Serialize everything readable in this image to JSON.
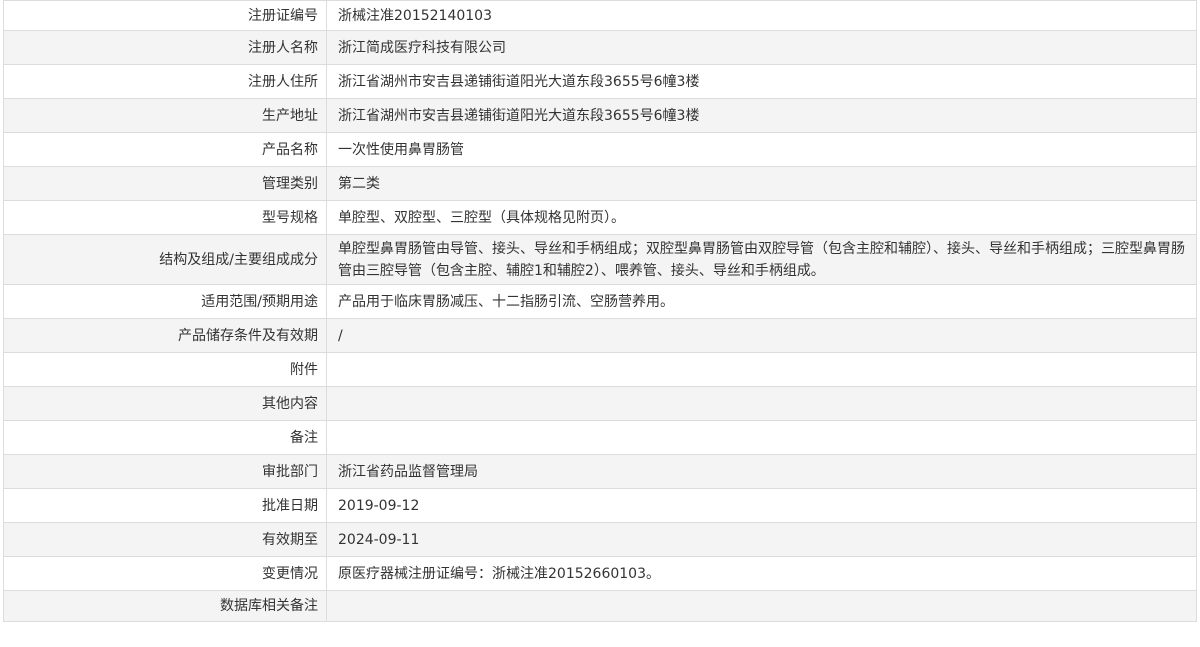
{
  "record": {
    "rows": [
      {
        "label": "注册证编号",
        "value": "浙械注准20152140103"
      },
      {
        "label": "注册人名称",
        "value": "浙江简成医疗科技有限公司"
      },
      {
        "label": "注册人住所",
        "value": "浙江省湖州市安吉县递铺街道阳光大道东段3655号6幢3楼"
      },
      {
        "label": "生产地址",
        "value": "浙江省湖州市安吉县递铺街道阳光大道东段3655号6幢3楼"
      },
      {
        "label": "产品名称",
        "value": "一次性使用鼻胃肠管"
      },
      {
        "label": "管理类别",
        "value": "第二类"
      },
      {
        "label": "型号规格",
        "value": "单腔型、双腔型、三腔型（具体规格见附页）。"
      },
      {
        "label": "结构及组成/主要组成成分",
        "value": "单腔型鼻胃肠管由导管、接头、导丝和手柄组成；双腔型鼻胃肠管由双腔导管（包含主腔和辅腔）、接头、导丝和手柄组成；三腔型鼻胃肠管由三腔导管（包含主腔、辅腔1和辅腔2）、喂养管、接头、导丝和手柄组成。"
      },
      {
        "label": "适用范围/预期用途",
        "value": "产品用于临床胃肠减压、十二指肠引流、空肠营养用。"
      },
      {
        "label": "产品储存条件及有效期",
        "value": "/"
      },
      {
        "label": "附件",
        "value": ""
      },
      {
        "label": "其他内容",
        "value": ""
      },
      {
        "label": "备注",
        "value": ""
      },
      {
        "label": "审批部门",
        "value": "浙江省药品监督管理局"
      },
      {
        "label": "批准日期",
        "value": "2019-09-12"
      },
      {
        "label": "有效期至",
        "value": "2024-09-11"
      },
      {
        "label": "变更情况",
        "value": "原医疗器械注册证编号：浙械注准20152660103。"
      },
      {
        "label": "数据库相关备注",
        "value": ""
      }
    ]
  }
}
